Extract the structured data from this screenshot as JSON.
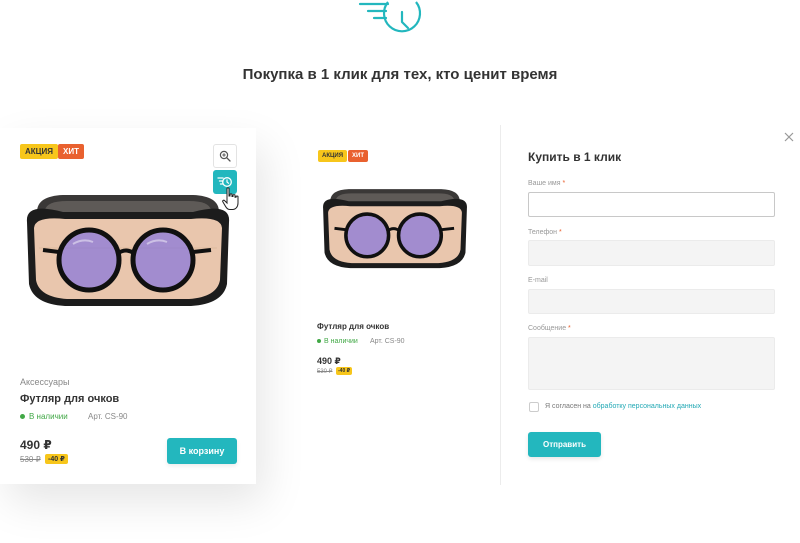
{
  "page": {
    "title": "Покупка в 1 клик для тех, кто ценит время"
  },
  "colors": {
    "accent": "#23b7be",
    "sale": "#f7c61b",
    "hit": "#e9612f",
    "stock": "#41a846"
  },
  "badges": {
    "sale": "АКЦИЯ",
    "hit": "ХИТ"
  },
  "card": {
    "category": "Аксессуары",
    "name": "Футляр для очков",
    "stock": "В наличии",
    "article": "Арт. CS-90",
    "price": "490 ₽",
    "old_price": "530 ₽",
    "discount": "-40 ₽",
    "cart_button": "В корзину"
  },
  "preview": {
    "name": "Футляр для очков",
    "stock": "В наличии",
    "article": "Арт. CS-90",
    "price": "490 ₽",
    "old_price": "530 ₽",
    "discount": "-40 ₽"
  },
  "form": {
    "title": "Купить в 1 клик",
    "name_label": "Ваше имя",
    "phone_label": "Телефон",
    "email_label": "E-mail",
    "message_label": "Сообщение",
    "required_mark": "*",
    "agree_prefix": "Я согласен на",
    "agree_link": "обработку персональных данных",
    "submit": "Отправить"
  },
  "icons": {
    "top": "fast-clock-icon",
    "zoom": "zoom-icon",
    "one_click": "fast-clock-icon",
    "cursor": "hand-cursor-icon",
    "close": "close-icon"
  }
}
